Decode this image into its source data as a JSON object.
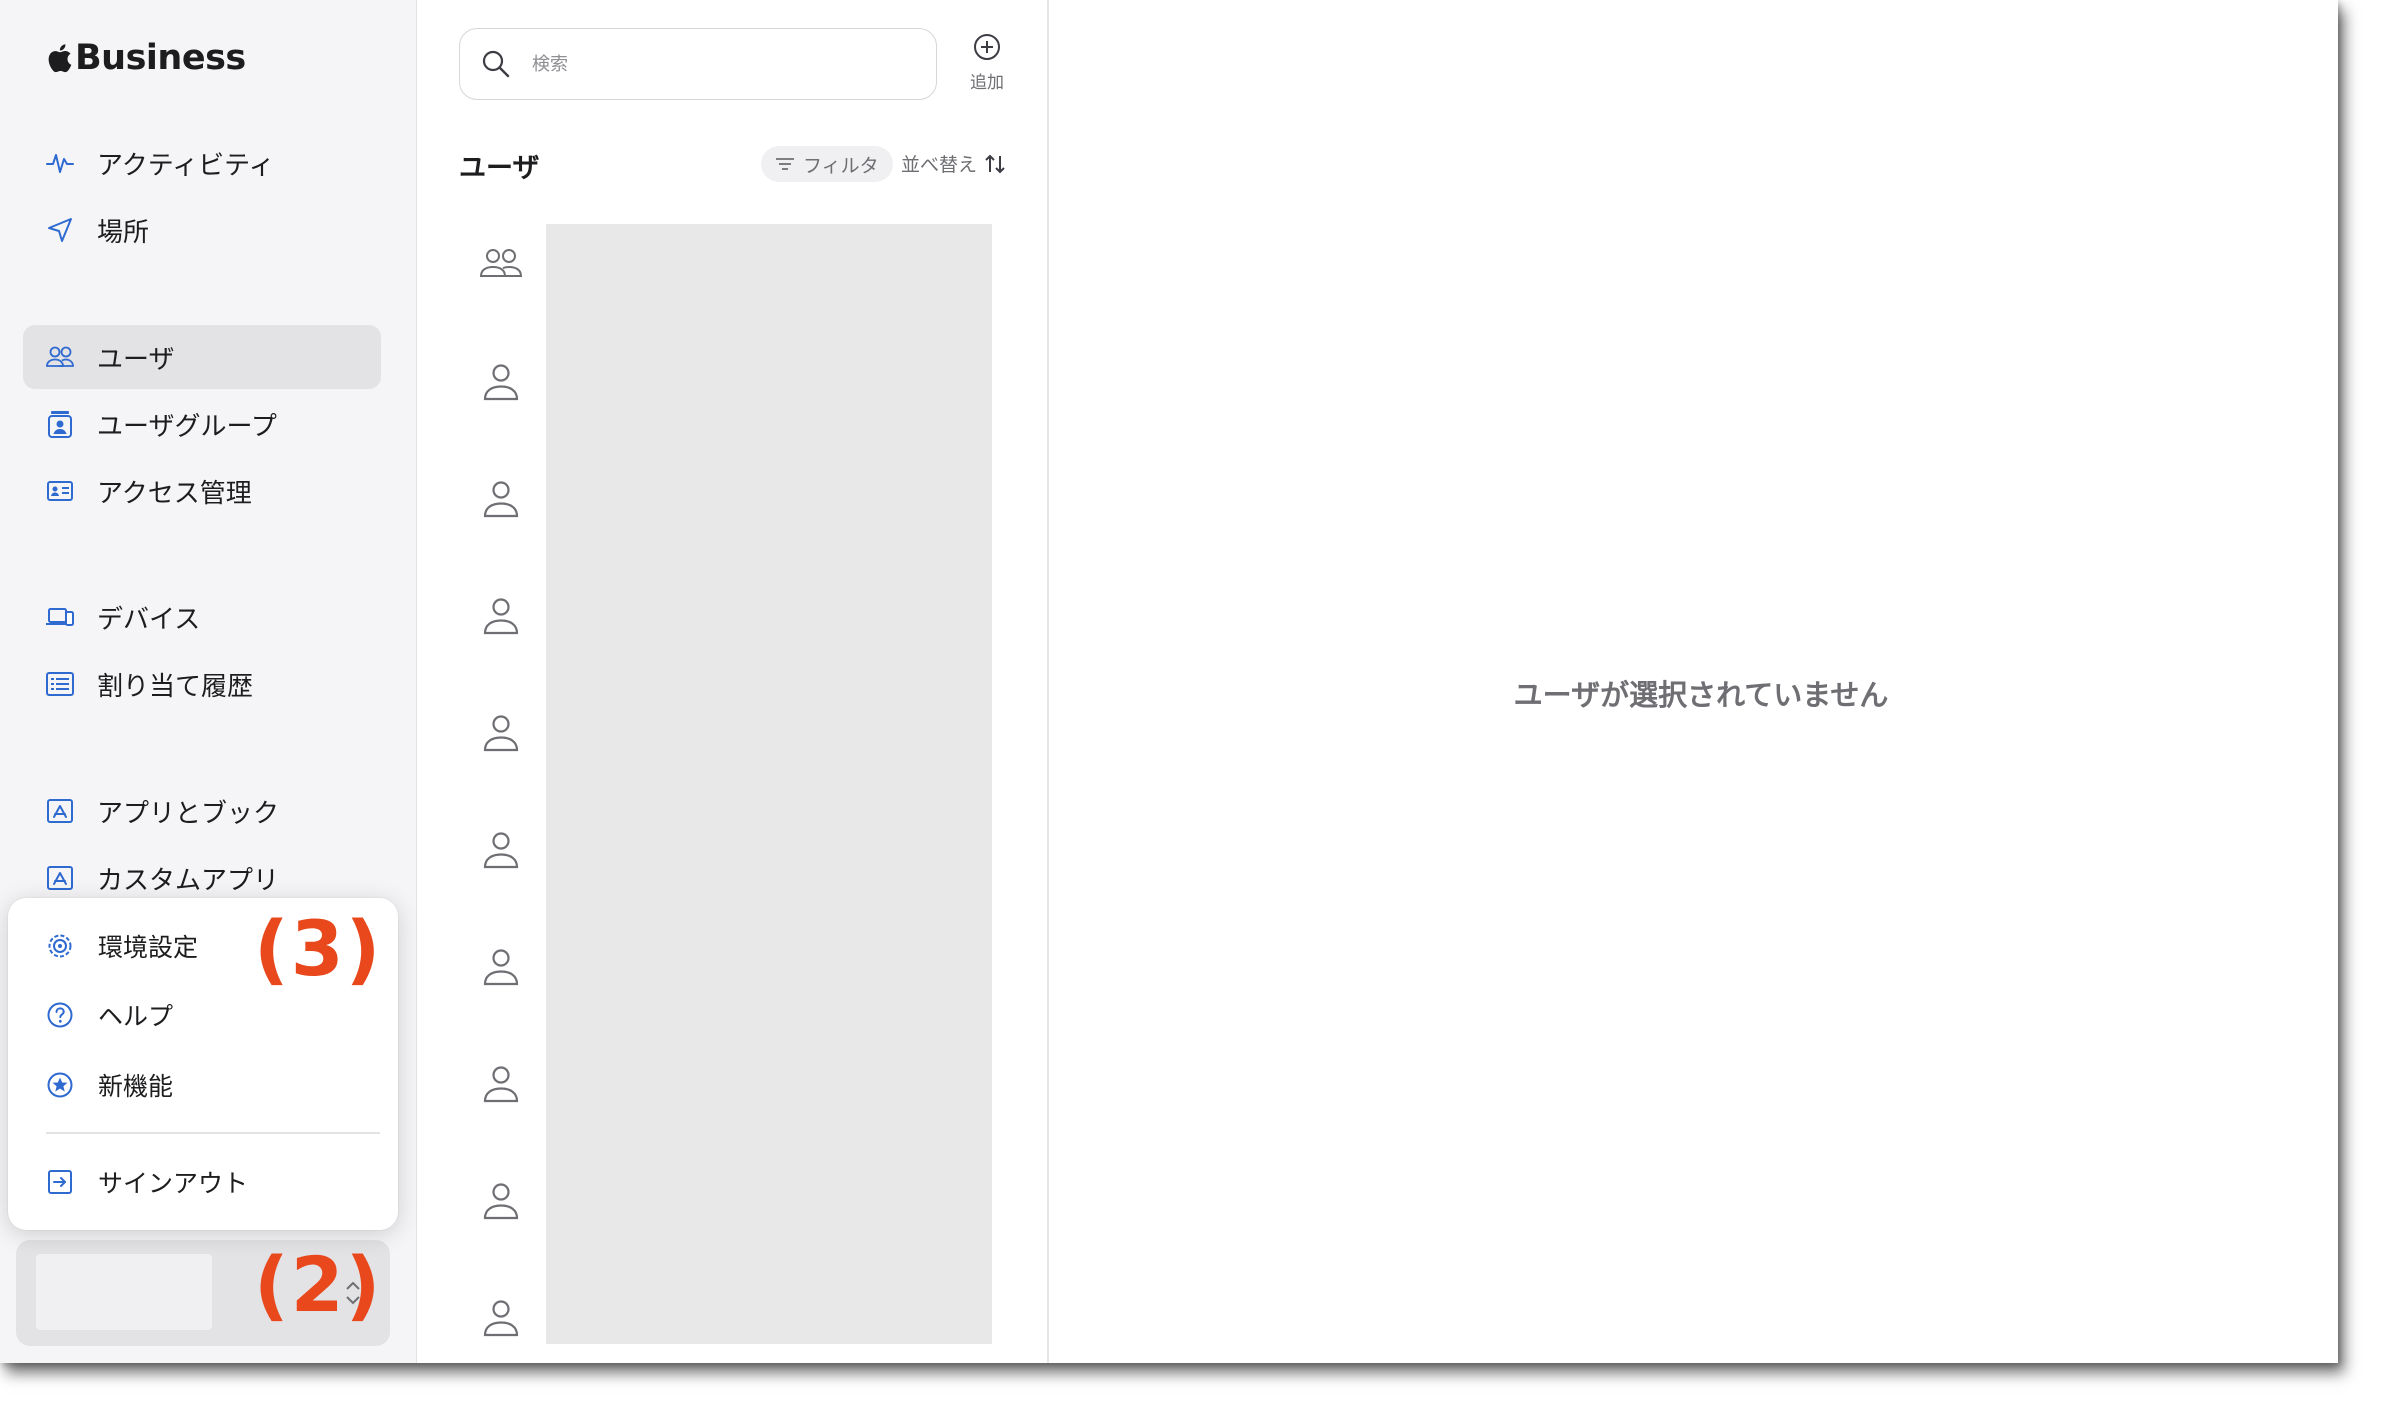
{
  "brand": {
    "name": "Business"
  },
  "sidebar": {
    "items": [
      {
        "label": "アクティビティ",
        "icon": "activity-icon"
      },
      {
        "label": "場所",
        "icon": "location-arrow-icon"
      },
      {
        "label": "ユーザ",
        "icon": "users-icon",
        "active": true
      },
      {
        "label": "ユーザグループ",
        "icon": "user-group-icon"
      },
      {
        "label": "アクセス管理",
        "icon": "id-card-icon"
      },
      {
        "label": "デバイス",
        "icon": "devices-icon"
      },
      {
        "label": "割り当て履歴",
        "icon": "list-icon"
      },
      {
        "label": "アプリとブック",
        "icon": "app-store-icon"
      },
      {
        "label": "カスタムアプリ",
        "icon": "app-store-icon"
      }
    ]
  },
  "popup_menu": {
    "items": [
      {
        "label": "環境設定",
        "icon": "gear-icon"
      },
      {
        "label": "ヘルプ",
        "icon": "help-icon"
      },
      {
        "label": "新機能",
        "icon": "star-icon"
      },
      {
        "label": "サインアウト",
        "icon": "sign-out-icon"
      }
    ]
  },
  "annotations": {
    "menu": "(3)",
    "account": "(2)"
  },
  "list": {
    "search_placeholder": "検索",
    "add_label": "追加",
    "title": "ユーザ",
    "filter_label": "フィルタ",
    "sort_label": "並べ替え",
    "rows": [
      {
        "icon": "group-icon"
      },
      {
        "icon": "person-icon"
      },
      {
        "icon": "person-icon"
      },
      {
        "icon": "person-icon"
      },
      {
        "icon": "person-icon"
      },
      {
        "icon": "person-icon"
      },
      {
        "icon": "person-icon"
      },
      {
        "icon": "person-icon"
      },
      {
        "icon": "person-icon"
      },
      {
        "icon": "person-icon"
      }
    ]
  },
  "detail": {
    "empty_message": "ユーザが選択されていません"
  },
  "colors": {
    "accent": "#2f6ad0",
    "annotation": "#e8481c",
    "sidebar_bg": "#f5f5f7",
    "active_bg": "#e3e3e6"
  }
}
